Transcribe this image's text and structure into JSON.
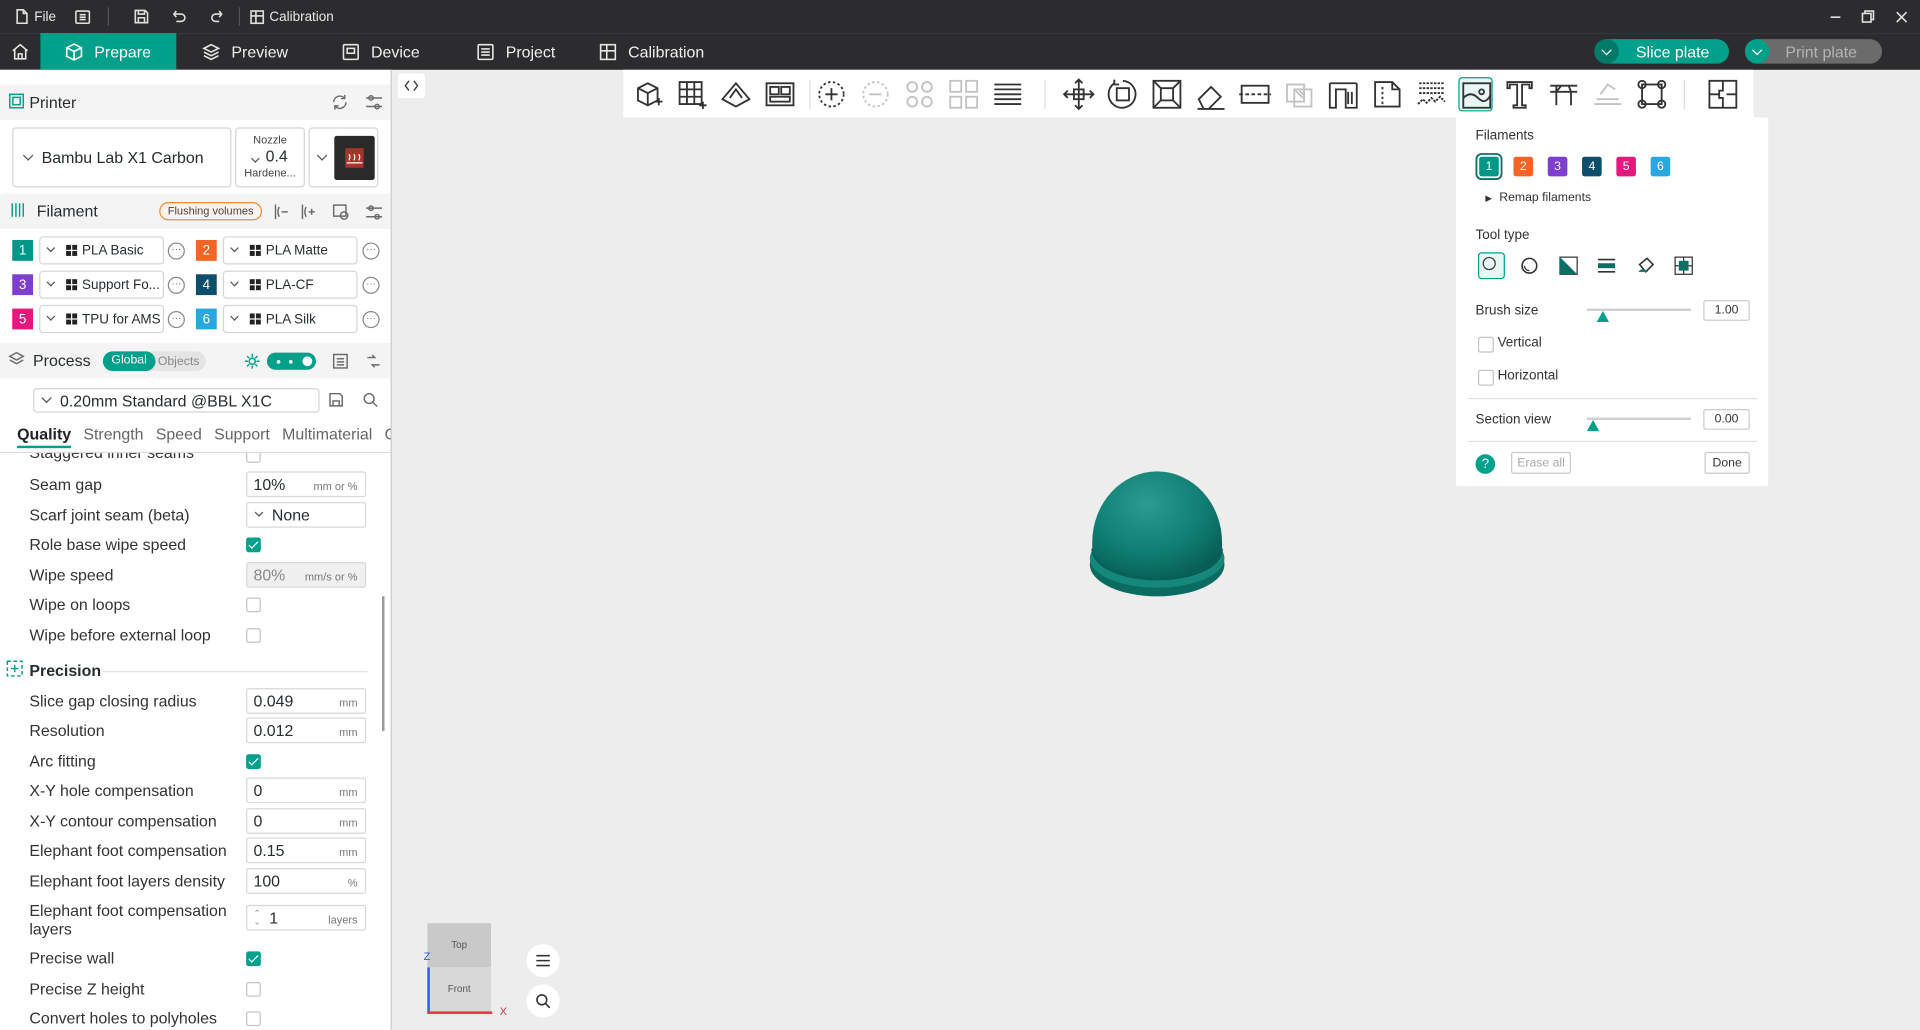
{
  "titlebar": {
    "file_label": "File",
    "title": "Calibration"
  },
  "tabs": {
    "prepare": "Prepare",
    "preview": "Preview",
    "device": "Device",
    "project": "Project",
    "calibration": "Calibration"
  },
  "actions": {
    "slice_plate": "Slice plate",
    "print_plate": "Print plate"
  },
  "colors": {
    "accent": "#00a08a",
    "titlebar": "#2c2c2e",
    "canvas": "#ededed",
    "model": "#0d7f73"
  },
  "printer": {
    "section_title": "Printer",
    "name": "Bambu Lab X1 Carbon",
    "nozzle_label": "Nozzle",
    "nozzle_value": "0.4",
    "nozzle_type": "Hardene..."
  },
  "filament": {
    "section_title": "Filament",
    "flushing_label": "Flushing volumes",
    "slots": [
      {
        "num": "1",
        "color": "#009688",
        "name": "PLA Basic"
      },
      {
        "num": "2",
        "color": "#f26522",
        "name": "PLA Matte"
      },
      {
        "num": "3",
        "color": "#7e3fcf",
        "name": "Support Fo..."
      },
      {
        "num": "4",
        "color": "#0d4f6b",
        "name": "PLA-CF"
      },
      {
        "num": "5",
        "color": "#e8177d",
        "name": "TPU for AMS"
      },
      {
        "num": "6",
        "color": "#29a8e0",
        "name": "PLA Silk"
      }
    ]
  },
  "process": {
    "section_title": "Process",
    "toggle_global": "Global",
    "toggle_objects": "Objects",
    "preset": "0.20mm Standard @BBL X1C",
    "tabs": [
      "Quality",
      "Strength",
      "Speed",
      "Support",
      "Multimaterial",
      "O"
    ]
  },
  "settings": {
    "cut_row": "Staggered inner seams",
    "seam_gap": {
      "label": "Seam gap",
      "value": "10%",
      "unit": "mm or %"
    },
    "scarf": {
      "label": "Scarf joint seam (beta)",
      "value": "None"
    },
    "role_base_wipe": {
      "label": "Role base wipe speed",
      "checked": true
    },
    "wipe_speed": {
      "label": "Wipe speed",
      "value": "80%",
      "unit": "mm/s or %"
    },
    "wipe_loops": {
      "label": "Wipe on loops",
      "checked": false
    },
    "wipe_before": {
      "label": "Wipe before external loop",
      "checked": false
    },
    "precision_title": "Precision",
    "slice_gap": {
      "label": "Slice gap closing radius",
      "value": "0.049",
      "unit": "mm"
    },
    "resolution": {
      "label": "Resolution",
      "value": "0.012",
      "unit": "mm"
    },
    "arc_fitting": {
      "label": "Arc fitting",
      "checked": true
    },
    "xy_hole": {
      "label": "X-Y hole compensation",
      "value": "0",
      "unit": "mm"
    },
    "xy_contour": {
      "label": "X-Y contour compensation",
      "value": "0",
      "unit": "mm"
    },
    "elephant": {
      "label": "Elephant foot compensation",
      "value": "0.15",
      "unit": "mm"
    },
    "elephant_density": {
      "label": "Elephant foot layers density",
      "value": "100",
      "unit": "%"
    },
    "elephant_layers": {
      "label1": "Elephant foot compensation",
      "label2": "layers",
      "value": "1",
      "unit": "layers"
    },
    "precise_wall": {
      "label": "Precise wall",
      "checked": true
    },
    "precise_z": {
      "label": "Precise Z height",
      "checked": false
    },
    "polyholes": {
      "label": "Convert holes to polyholes",
      "checked": false
    }
  },
  "paint_panel": {
    "filaments_title": "Filaments",
    "remap_label": "Remap filaments",
    "tool_type_title": "Tool type",
    "brush_size_label": "Brush size",
    "brush_size_value": "1.00",
    "vertical_label": "Vertical",
    "horizontal_label": "Horizontal",
    "section_view_label": "Section view",
    "section_view_value": "0.00",
    "erase_all_label": "Erase all",
    "done_label": "Done"
  },
  "viewcube": {
    "top": "Top",
    "front": "Front",
    "x_axis": "X",
    "z_axis": "Z"
  }
}
